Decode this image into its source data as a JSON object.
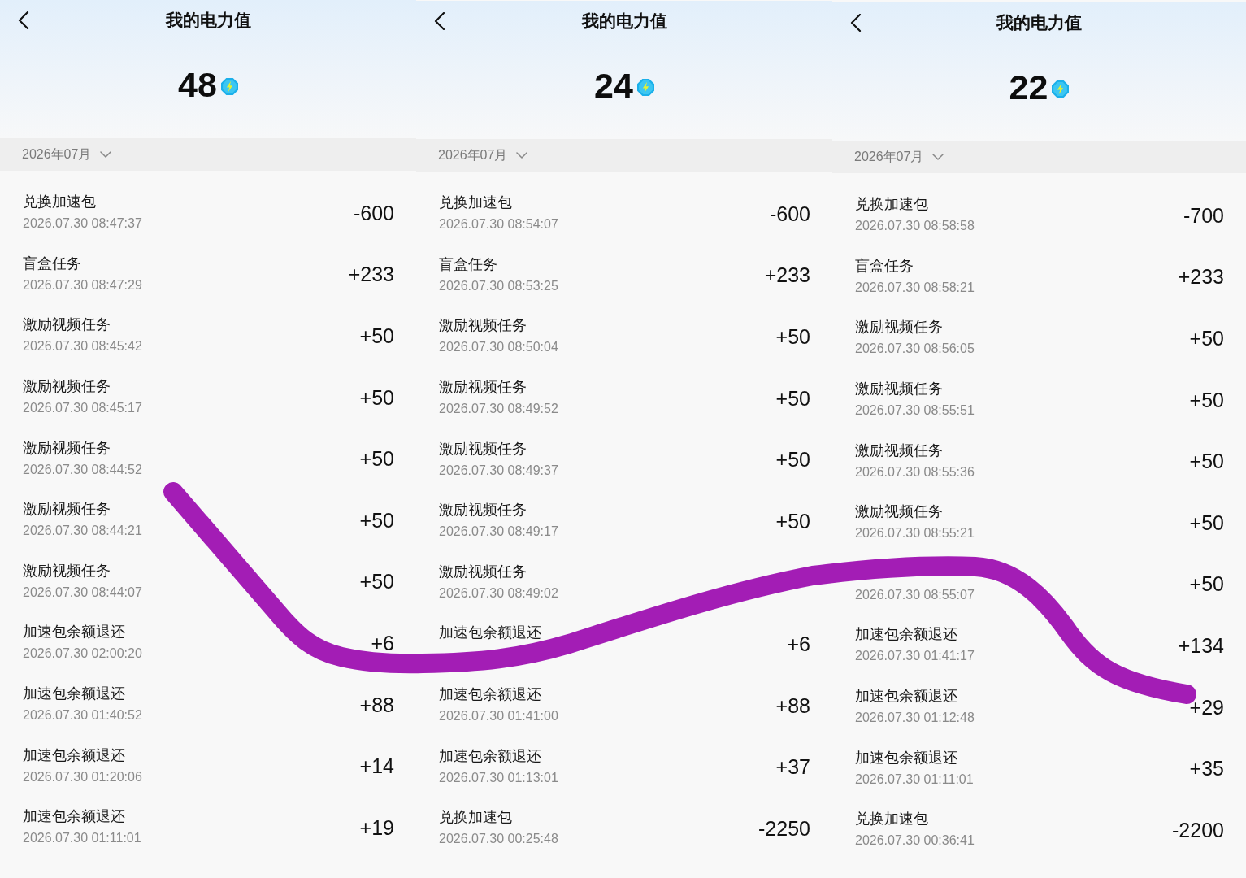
{
  "panels": [
    {
      "title": "我的电力值",
      "balance": "48",
      "month": "2026年07月",
      "records": [
        {
          "title": "兑换加速包",
          "time": "2026.07.30 08:47:37",
          "amount": "-600"
        },
        {
          "title": "盲盒任务",
          "time": "2026.07.30 08:47:29",
          "amount": "+233"
        },
        {
          "title": "激励视频任务",
          "time": "2026.07.30 08:45:42",
          "amount": "+50"
        },
        {
          "title": "激励视频任务",
          "time": "2026.07.30 08:45:17",
          "amount": "+50"
        },
        {
          "title": "激励视频任务",
          "time": "2026.07.30 08:44:52",
          "amount": "+50"
        },
        {
          "title": "激励视频任务",
          "time": "2026.07.30 08:44:21",
          "amount": "+50"
        },
        {
          "title": "激励视频任务",
          "time": "2026.07.30 08:44:07",
          "amount": "+50"
        },
        {
          "title": "加速包余额退还",
          "time": "2026.07.30 02:00:20",
          "amount": "+6"
        },
        {
          "title": "加速包余额退还",
          "time": "2026.07.30 01:40:52",
          "amount": "+88"
        },
        {
          "title": "加速包余额退还",
          "time": "2026.07.30 01:20:06",
          "amount": "+14"
        },
        {
          "title": "加速包余额退还",
          "time": "2026.07.30 01:11:01",
          "amount": "+19"
        }
      ]
    },
    {
      "title": "我的电力值",
      "balance": "24",
      "month": "2026年07月",
      "records": [
        {
          "title": "兑换加速包",
          "time": "2026.07.30 08:54:07",
          "amount": "-600"
        },
        {
          "title": "盲盒任务",
          "time": "2026.07.30 08:53:25",
          "amount": "+233"
        },
        {
          "title": "激励视频任务",
          "time": "2026.07.30 08:50:04",
          "amount": "+50"
        },
        {
          "title": "激励视频任务",
          "time": "2026.07.30 08:49:52",
          "amount": "+50"
        },
        {
          "title": "激励视频任务",
          "time": "2026.07.30 08:49:37",
          "amount": "+50"
        },
        {
          "title": "激励视频任务",
          "time": "2026.07.30 08:49:17",
          "amount": "+50"
        },
        {
          "title": "激励视频任务",
          "time": "2026.07.30 08:49:02"
        },
        {
          "title": "加速包余额退还",
          "amount": "+6"
        },
        {
          "title": "加速包余额退还",
          "time": "2026.07.30 01:41:00",
          "amount": "+88"
        },
        {
          "title": "加速包余额退还",
          "time": "2026.07.30 01:13:01",
          "amount": "+37"
        },
        {
          "title": "兑换加速包",
          "time": "2026.07.30 00:25:48",
          "amount": "-2250"
        }
      ]
    },
    {
      "title": "我的电力值",
      "balance": "22",
      "month": "2026年07月",
      "records": [
        {
          "title": "兑换加速包",
          "time": "2026.07.30 08:58:58",
          "amount": "-700"
        },
        {
          "title": "盲盒任务",
          "time": "2026.07.30 08:58:21",
          "amount": "+233"
        },
        {
          "title": "激励视频任务",
          "time": "2026.07.30 08:56:05",
          "amount": "+50"
        },
        {
          "title": "激励视频任务",
          "time": "2026.07.30 08:55:51",
          "amount": "+50"
        },
        {
          "title": "激励视频任务",
          "time": "2026.07.30 08:55:36",
          "amount": "+50"
        },
        {
          "title": "激励视频任务",
          "time": "2026.07.30 08:55:21",
          "amount": "+50"
        },
        {
          "time": "2026.07.30 08:55:07",
          "amount": "+50"
        },
        {
          "title": "加速包余额退还",
          "time": "2026.07.30 01:41:17",
          "amount": "+134"
        },
        {
          "title": "加速包余额退还",
          "time": "2026.07.30 01:12:48",
          "amount": "+29"
        },
        {
          "title": "加速包余额退还",
          "time": "2026.07.30 01:11:01",
          "amount": "+35"
        },
        {
          "title": "兑换加速包",
          "time": "2026.07.30 00:36:41",
          "amount": "-2200"
        }
      ]
    }
  ]
}
